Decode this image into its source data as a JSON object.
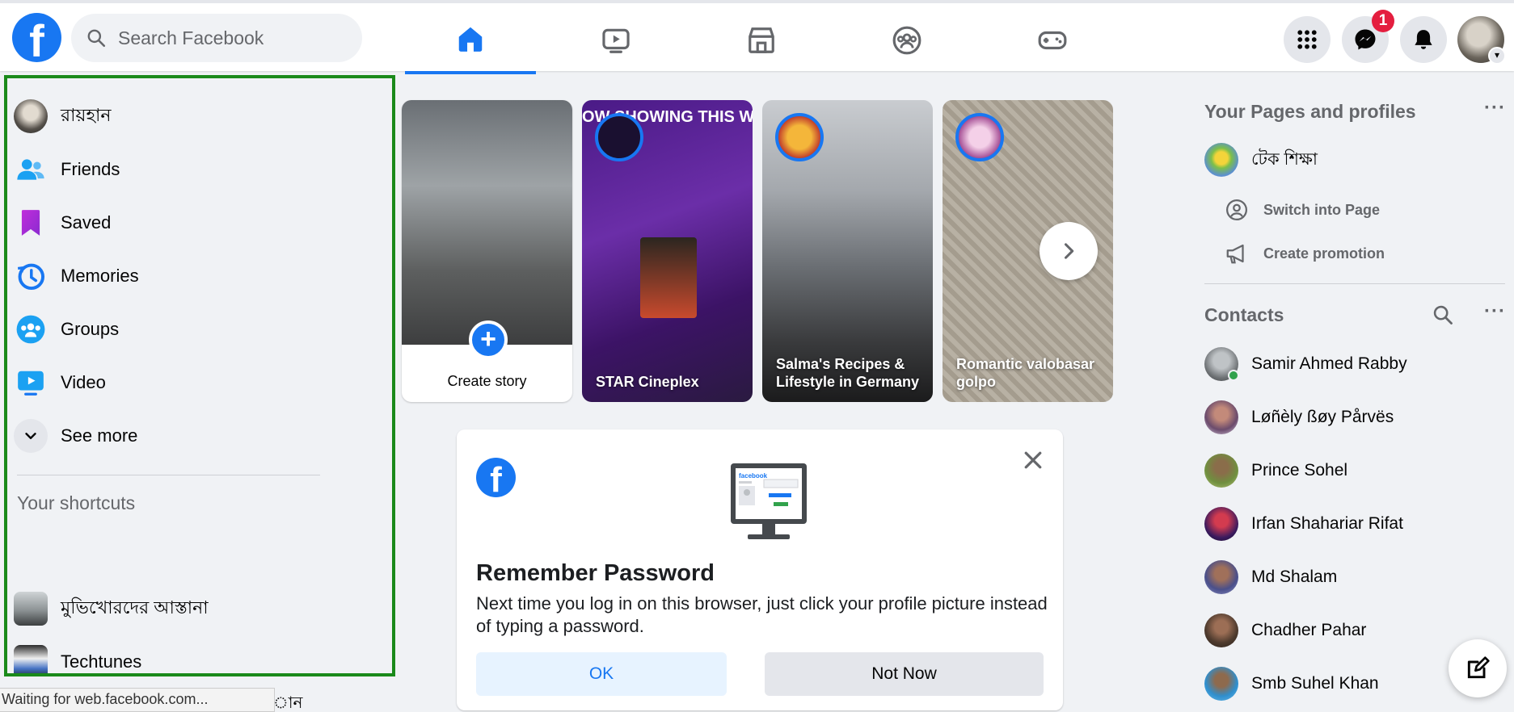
{
  "header": {
    "logo": "f",
    "search_placeholder": "Search Facebook",
    "nav_tabs": [
      "home",
      "watch",
      "marketplace",
      "groups",
      "gaming"
    ],
    "messenger_badge": "1"
  },
  "sidebar": {
    "items": [
      {
        "label": "রায়হান",
        "icon": "profile-avatar"
      },
      {
        "label": "Friends",
        "icon": "friends-icon"
      },
      {
        "label": "Saved",
        "icon": "bookmark-icon"
      },
      {
        "label": "Memories",
        "icon": "clock-icon"
      },
      {
        "label": "Groups",
        "icon": "groups-icon"
      },
      {
        "label": "Video",
        "icon": "video-icon"
      },
      {
        "label": "See more",
        "icon": "chevron-down-icon"
      }
    ],
    "shortcuts_title": "Your shortcuts",
    "shortcuts": [
      {
        "label": "মুভিখোরদের আস্তানা"
      },
      {
        "label": "Techtunes"
      }
    ]
  },
  "stories": {
    "create_label": "Create story",
    "items": [
      {
        "title": "STAR Cineplex",
        "banner": "OW SHOWING THIS WEE"
      },
      {
        "title": "Salma's Recipes & Lifestyle in Germany"
      },
      {
        "title": "Romantic valobasar golpo"
      }
    ]
  },
  "remember_password": {
    "title": "Remember Password",
    "text": "Next time you log in on this browser, just click your profile picture instead of typing a password.",
    "ok_label": "OK",
    "not_now_label": "Not Now",
    "monitor_text": "facebook"
  },
  "right_rail": {
    "pages_title": "Your Pages and profiles",
    "page_name": "টেক শিক্ষা",
    "switch_label": "Switch into Page",
    "promotion_label": "Create promotion",
    "contacts_title": "Contacts",
    "contacts": [
      {
        "name": "Samir Ahmed Rabby",
        "online": true
      },
      {
        "name": "Løñèly ßøy Pårvës",
        "online": false
      },
      {
        "name": "Prince Sohel",
        "online": false
      },
      {
        "name": "Irfan Shahariar Rifat",
        "online": false
      },
      {
        "name": "Md Shalam",
        "online": false
      },
      {
        "name": "Chadher Pahar",
        "online": false
      },
      {
        "name": "Smb Suhel Khan",
        "online": false
      }
    ]
  },
  "status": {
    "text": "Waiting for web.facebook.com...",
    "behind_text": "ান"
  },
  "colors": {
    "brand": "#1877f2",
    "highlight_border": "#1a8a1a",
    "badge": "#e41e3f"
  }
}
